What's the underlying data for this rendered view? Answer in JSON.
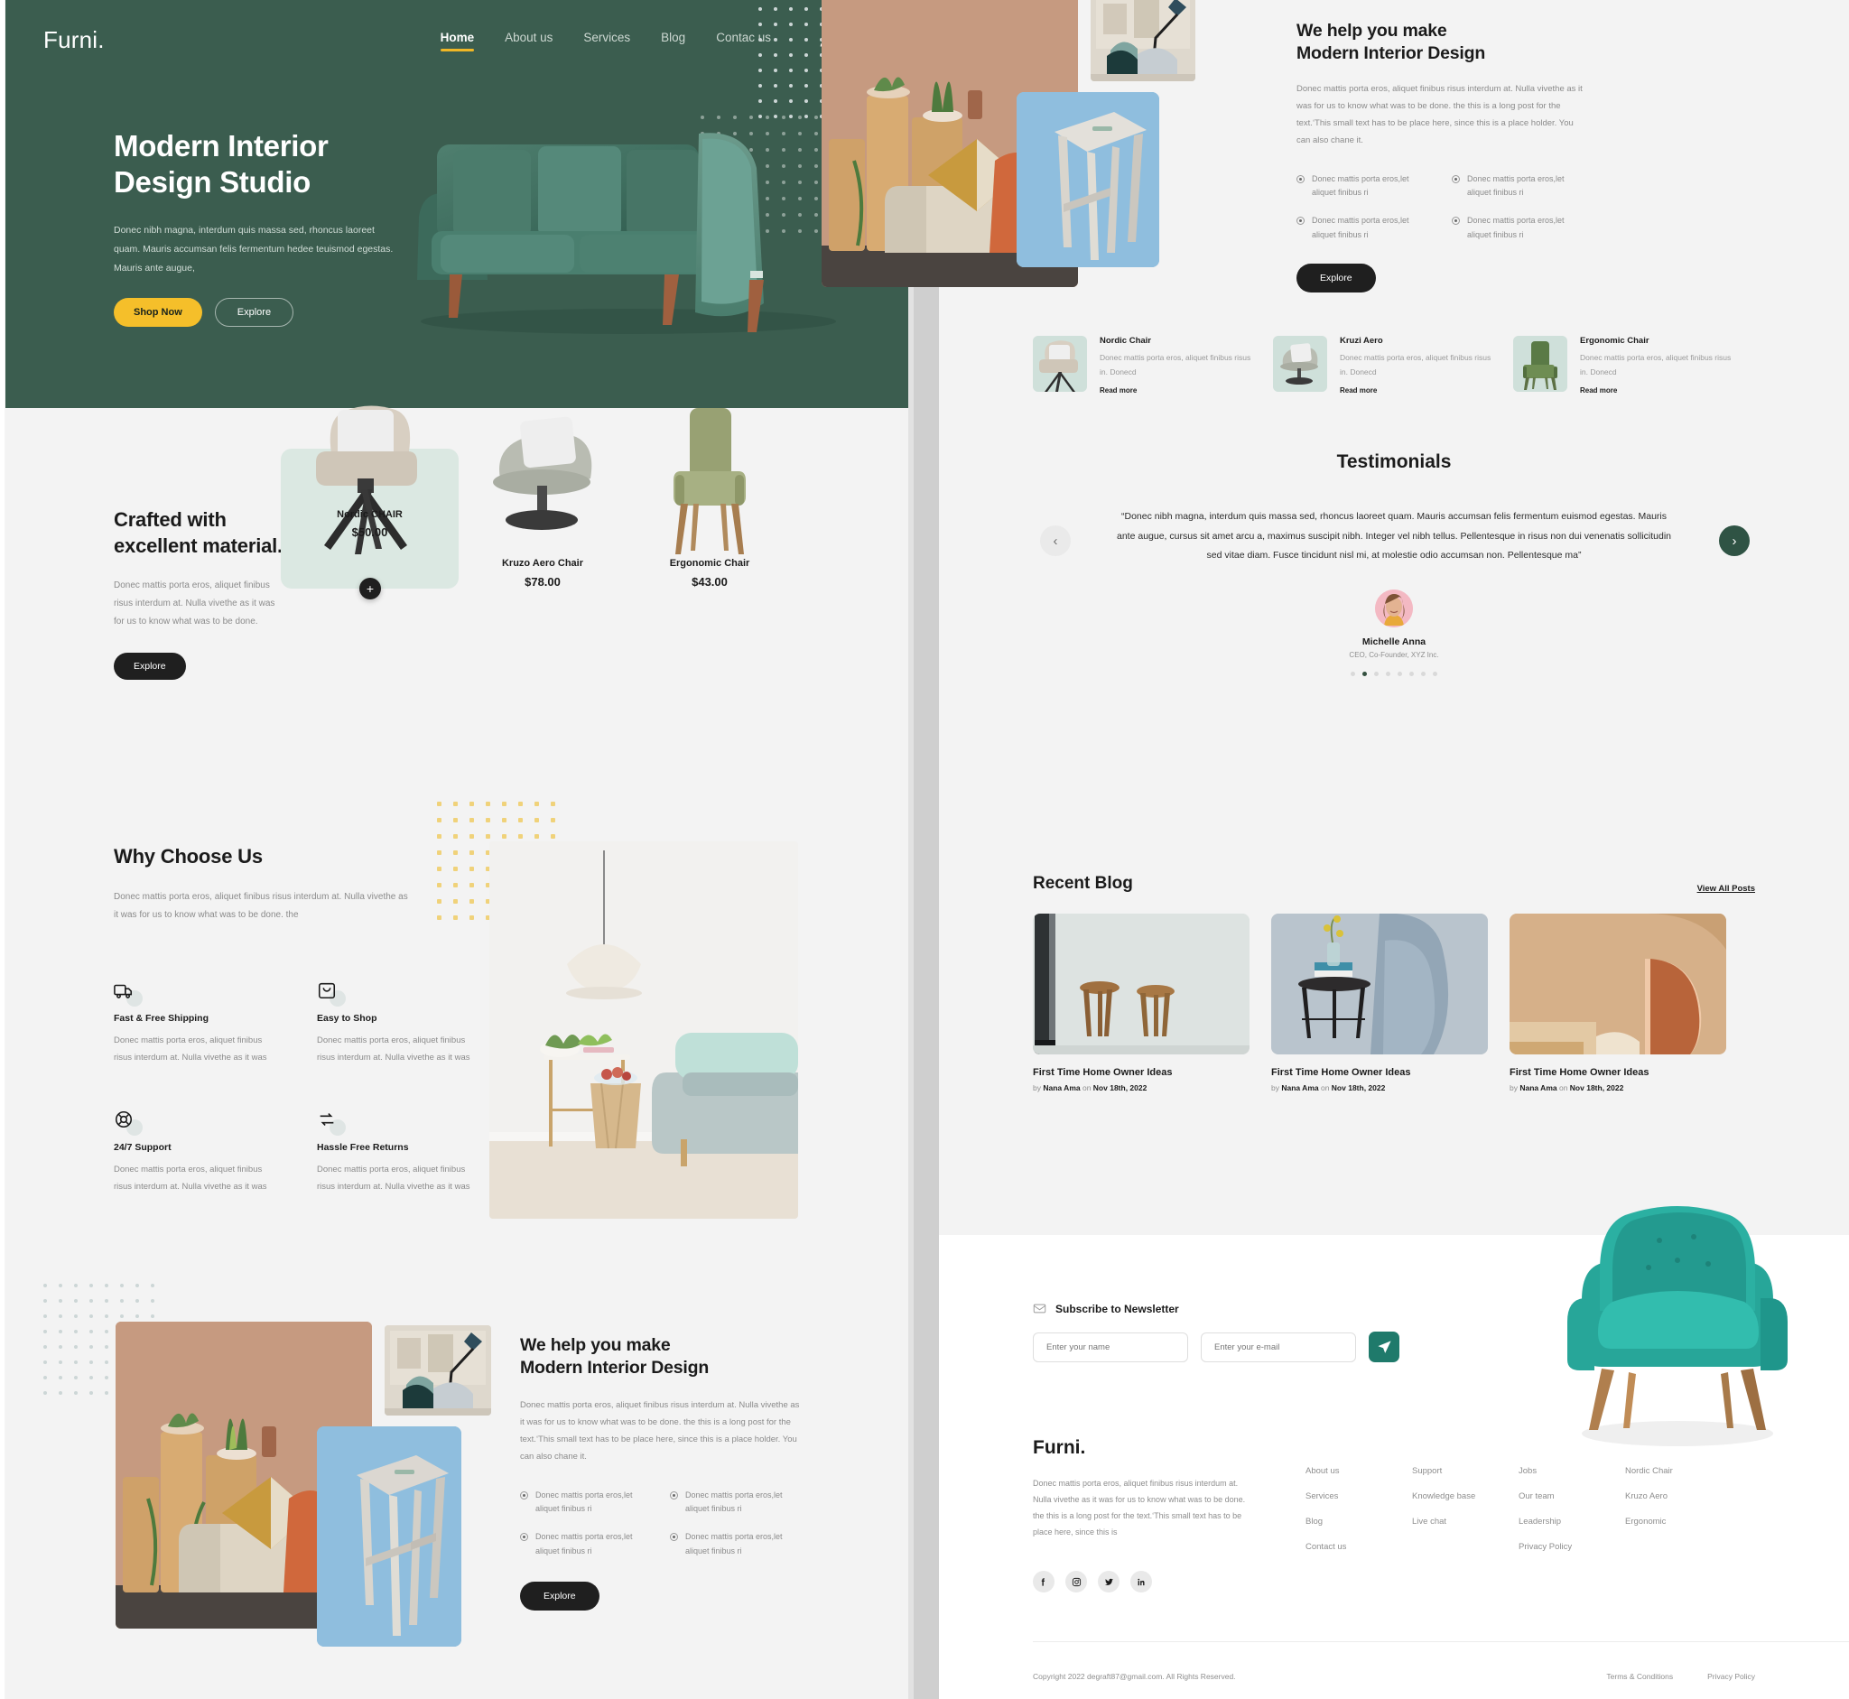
{
  "brand": "Furni.",
  "nav": {
    "links": [
      {
        "label": "Home",
        "active": true
      },
      {
        "label": "About us",
        "active": false
      },
      {
        "label": "Services",
        "active": false
      },
      {
        "label": "Blog",
        "active": false
      },
      {
        "label": "Contac us",
        "active": false
      }
    ],
    "icons": [
      "user-icon",
      "cart-icon"
    ]
  },
  "hero": {
    "title_line1": "Modern Interior",
    "title_line2": "Design Studio",
    "paragraph": "Donec nibh magna, interdum quis massa sed, rhoncus laoreet quam. Mauris accumsan felis fermentum hedee teuismod egestas. Mauris ante augue,",
    "primary_button": "Shop Now",
    "secondary_button": "Explore",
    "bg_color": "#3b5d4f",
    "accent_color": "#f5bf2a"
  },
  "crafted": {
    "title": "Crafted with excellent material.",
    "paragraph": "Donec mattis porta eros, aliquet finibus risus interdum at. Nulla vivethe as it was for us to know what was to be done.",
    "button": "Explore",
    "products": [
      {
        "name": "Nordic CHAIR",
        "price": "$50.00",
        "featured": true
      },
      {
        "name": "Kruzo Aero Chair",
        "price": "$78.00",
        "featured": false
      },
      {
        "name": "Ergonomic Chair",
        "price": "$43.00",
        "featured": false
      }
    ]
  },
  "why": {
    "title": "Why Choose Us",
    "paragraph": "Donec mattis porta eros, aliquet finibus risus interdum at. Nulla vivethe as it was for us to know what was to be done. the",
    "features": [
      {
        "icon": "truck-icon",
        "title": "Fast  & Free Shipping",
        "text": "Donec mattis porta eros, aliquet finibus risus interdum at. Nulla vivethe as it was"
      },
      {
        "icon": "shopping-bag-icon",
        "title": "Easy to Shop",
        "text": "Donec mattis porta eros, aliquet finibus risus interdum at. Nulla vivethe as it was"
      },
      {
        "icon": "lifebuoy-icon",
        "title": "24/7 Support",
        "text": "Donec mattis porta eros, aliquet finibus risus interdum at. Nulla vivethe as it was"
      },
      {
        "icon": "return-arrows-icon",
        "title": "Hassle Free Returns",
        "text": "Donec mattis porta eros, aliquet finibus risus interdum at. Nulla vivethe as it was"
      }
    ]
  },
  "help": {
    "title_line1": "We help  you make",
    "title_line2": "Modern Interior Design",
    "paragraph": "Donec mattis porta eros, aliquet finibus risus interdum at. Nulla vivethe as it was for us to know what was to be done. the this is a long  post for the text.‘This small text has to be place here, since this is a place holder. You can also chane it.",
    "bullets": [
      "Donec mattis porta eros,let aliquet finibus ri",
      "Donec mattis porta eros,let aliquet finibus ri",
      "Donec mattis porta eros,let aliquet finibus ri",
      "Donec mattis porta eros,let aliquet finibus ri"
    ],
    "button": "Explore"
  },
  "product_list": [
    {
      "name": "Nordic Chair",
      "text": "Donec mattis porta eros, aliquet finibus risus in. Donecd",
      "link": "Read more"
    },
    {
      "name": "Kruzi Aero",
      "text": "Donec mattis porta eros, aliquet finibus risus in. Donecd",
      "link": "Read more"
    },
    {
      "name": "Ergonomic Chair",
      "text": "Donec mattis porta eros, aliquet finibus risus in. Donecd",
      "link": "Read more"
    }
  ],
  "testimonials": {
    "title": "Testimonials",
    "quote": "“Donec nibh magna, interdum quis massa sed, rhoncus laoreet quam. Mauris accumsan felis fermentum euismod egestas. Mauris ante augue, cursus sit amet arcu a, maximus suscipit nibh. Integer vel nibh tellus. Pellentesque in risus non dui venenatis sollicitudin sed vitae diam. Fusce tincidunt nisl mi, at molestie odio accumsan non. Pellentesque ma”",
    "author": "Michelle Anna",
    "role": "CEO, Co-Founder, XYZ Inc.",
    "dot_count": 8,
    "active_dot": 1,
    "prev_label": "‹",
    "next_label": "›",
    "next_color": "#2f5344"
  },
  "blog": {
    "title": "Recent Blog",
    "view_all": "View All Posts",
    "posts": [
      {
        "title": "First Time Home Owner Ideas",
        "meta_pre": "by ",
        "author": "Nana Ama",
        "meta_mid": " on ",
        "date": "Nov 18th, 2022"
      },
      {
        "title": "First Time Home Owner Ideas",
        "meta_pre": "by ",
        "author": "Nana Ama",
        "meta_mid": " on ",
        "date": "Nov 18th, 2022"
      },
      {
        "title": "First Time Home Owner Ideas",
        "meta_pre": "by ",
        "author": "Nana Ama",
        "meta_mid": " on ",
        "date": "Nov 18th, 2022"
      }
    ]
  },
  "newsletter": {
    "label": "Subscribe to Newsletter",
    "name_placeholder": "Enter your name",
    "email_placeholder": "Enter your e-mail",
    "send_icon": "paper-plane-icon",
    "send_color": "#1f7a6b"
  },
  "footer": {
    "brand": "Furni.",
    "description": "Donec mattis porta eros, aliquet finibus risus interdum at. Nulla vivethe as it was for us to know what was to be done. the this is a long  post for the text.‘This small text has to be place here, since this is",
    "columns": [
      [
        "About us",
        "Services",
        "Blog",
        "Contact us"
      ],
      [
        "Support",
        "Knowledge base",
        "Live chat"
      ],
      [
        "Jobs",
        "Our team",
        "Leadership",
        "Privacy Policy"
      ],
      [
        "Nordic Chair",
        "Kruzo Aero",
        "Ergonomic"
      ]
    ],
    "socials": [
      "facebook-icon",
      "instagram-icon",
      "twitter-icon",
      "linkedin-icon"
    ],
    "copyright": "Copyright 2022 degraft87@gmail.com. All Rights Reserved.",
    "legal": [
      "Terms & Conditions",
      "Privacy Policy"
    ]
  }
}
